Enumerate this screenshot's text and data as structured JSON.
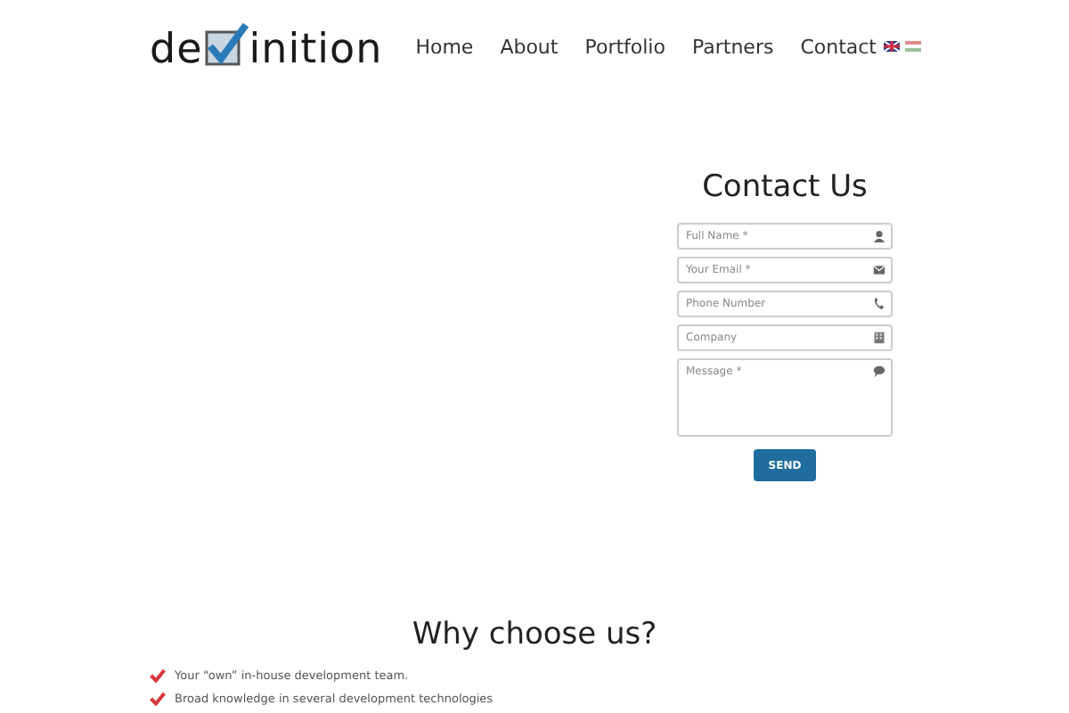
{
  "header": {
    "logo": {
      "before": "de",
      "after": "inition"
    },
    "nav": [
      {
        "label": "Home"
      },
      {
        "label": "About"
      },
      {
        "label": "Portfolio"
      },
      {
        "label": "Partners"
      },
      {
        "label": "Contact"
      }
    ],
    "languages": [
      {
        "kind": "uk"
      },
      {
        "kind": "hu"
      }
    ]
  },
  "contact_form": {
    "title": "Contact Us",
    "fields": [
      {
        "placeholder": "Full Name *",
        "kind": "name"
      },
      {
        "placeholder": "Your Email *",
        "kind": "email"
      },
      {
        "placeholder": "Phone Number",
        "kind": "phone"
      },
      {
        "placeholder": "Company",
        "kind": "company"
      },
      {
        "placeholder": "Message *",
        "kind": "message"
      }
    ],
    "button": "SEND"
  },
  "why": {
    "title": "Why choose us?",
    "items": [
      "Your “own” in-house development team.",
      "Broad knowledge in several development technologies"
    ]
  }
}
